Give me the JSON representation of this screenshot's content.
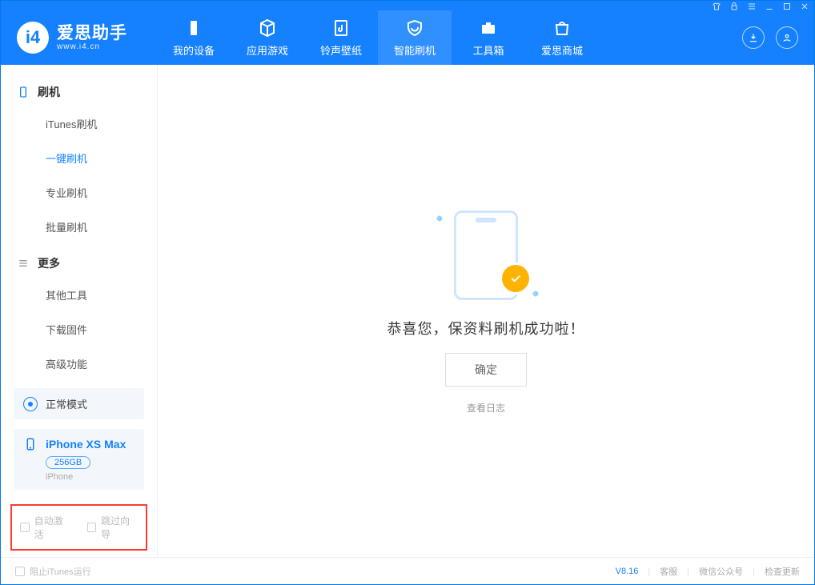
{
  "app": {
    "name_cn": "爱思助手",
    "url": "www.i4.cn"
  },
  "nav": {
    "tabs": [
      {
        "label": "我的设备"
      },
      {
        "label": "应用游戏"
      },
      {
        "label": "铃声壁纸"
      },
      {
        "label": "智能刷机"
      },
      {
        "label": "工具箱"
      },
      {
        "label": "爱思商城"
      }
    ]
  },
  "sidebar": {
    "flash_header": "刷机",
    "flash_items": [
      {
        "label": "iTunes刷机"
      },
      {
        "label": "一键刷机"
      },
      {
        "label": "专业刷机"
      },
      {
        "label": "批量刷机"
      }
    ],
    "more_header": "更多",
    "more_items": [
      {
        "label": "其他工具"
      },
      {
        "label": "下载固件"
      },
      {
        "label": "高级功能"
      }
    ],
    "status_mode": "正常模式",
    "device_name": "iPhone XS Max",
    "device_capacity": "256GB",
    "device_type": "iPhone",
    "auto_activate": "自动激活",
    "skip_guide": "跳过向导"
  },
  "main": {
    "message": "恭喜您，保资料刷机成功啦！",
    "ok": "确定",
    "view_log": "查看日志"
  },
  "footer": {
    "block_itunes": "阻止iTunes运行",
    "version": "V8.16",
    "support": "客服",
    "wechat": "微信公众号",
    "update": "检查更新"
  }
}
